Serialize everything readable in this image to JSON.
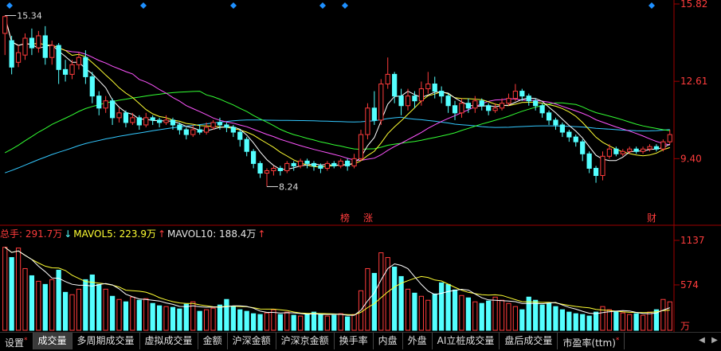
{
  "chart_data": [
    {
      "type": "candlestick",
      "panel": "price",
      "ylim": [
        7.0,
        15.82
      ],
      "y_ticks": [
        "15.82",
        "12.61",
        "9.40"
      ],
      "annotations": {
        "high": "15.34",
        "low": "8.24"
      },
      "event_markers": [
        "榜",
        "涨",
        "财"
      ],
      "candles": [
        [
          14.6,
          15.3,
          15.34,
          13.7
        ],
        [
          14.3,
          13.2,
          14.5,
          12.9
        ],
        [
          13.4,
          13.8,
          14.1,
          13.2
        ],
        [
          13.7,
          14.4,
          14.6,
          13.5
        ],
        [
          14.4,
          14.0,
          14.8,
          13.7
        ],
        [
          14.0,
          14.5,
          14.7,
          13.8
        ],
        [
          14.5,
          13.6,
          14.9,
          13.3
        ],
        [
          13.6,
          14.1,
          14.3,
          13.3
        ],
        [
          14.1,
          13.1,
          14.2,
          12.5
        ],
        [
          13.1,
          12.9,
          13.5,
          12.6
        ],
        [
          12.9,
          13.3,
          13.5,
          12.7
        ],
        [
          13.3,
          13.6,
          13.8,
          13.1
        ],
        [
          13.6,
          12.8,
          13.9,
          12.5
        ],
        [
          12.8,
          12.0,
          13.0,
          11.7
        ],
        [
          12.0,
          11.5,
          12.2,
          11.2
        ],
        [
          11.5,
          11.8,
          12.0,
          11.3
        ],
        [
          11.8,
          11.1,
          11.9,
          10.8
        ],
        [
          11.1,
          11.3,
          11.5,
          10.9
        ],
        [
          11.3,
          10.9,
          11.4,
          10.7
        ],
        [
          10.9,
          11.1,
          11.3,
          10.8
        ],
        [
          11.1,
          10.8,
          11.2,
          10.6
        ],
        [
          10.8,
          11.1,
          11.3,
          10.7
        ],
        [
          11.1,
          11.0,
          11.2,
          10.8
        ],
        [
          11.0,
          10.9,
          11.1,
          10.7
        ],
        [
          10.9,
          11.0,
          11.2,
          10.8
        ],
        [
          11.0,
          10.8,
          11.1,
          10.6
        ],
        [
          10.8,
          10.6,
          10.9,
          10.4
        ],
        [
          10.6,
          10.4,
          10.7,
          10.2
        ],
        [
          10.4,
          10.6,
          10.8,
          10.3
        ],
        [
          10.6,
          10.5,
          10.8,
          10.4
        ],
        [
          10.5,
          10.7,
          10.9,
          10.4
        ],
        [
          10.7,
          10.9,
          11.0,
          10.6
        ],
        [
          10.9,
          10.8,
          11.1,
          10.6
        ],
        [
          10.8,
          10.7,
          10.9,
          10.5
        ],
        [
          10.7,
          10.5,
          10.8,
          10.3
        ],
        [
          10.5,
          10.2,
          10.6,
          9.9
        ],
        [
          10.2,
          9.7,
          10.3,
          9.5
        ],
        [
          9.7,
          9.2,
          9.8,
          9.0
        ],
        [
          9.2,
          8.8,
          9.3,
          8.6
        ],
        [
          8.8,
          8.9,
          9.0,
          8.24
        ],
        [
          8.9,
          9.0,
          9.1,
          8.7
        ],
        [
          9.0,
          8.9,
          9.1,
          8.7
        ],
        [
          8.9,
          9.2,
          9.3,
          8.8
        ],
        [
          9.2,
          9.1,
          9.3,
          8.9
        ],
        [
          9.1,
          9.3,
          9.4,
          9.0
        ],
        [
          9.3,
          9.2,
          9.4,
          9.0
        ],
        [
          9.2,
          9.1,
          9.3,
          8.9
        ],
        [
          9.1,
          9.0,
          9.2,
          8.8
        ],
        [
          9.0,
          9.2,
          9.3,
          8.9
        ],
        [
          9.2,
          9.1,
          9.3,
          9.0
        ],
        [
          9.1,
          9.3,
          9.4,
          9.0
        ],
        [
          9.3,
          9.1,
          9.4,
          8.9
        ],
        [
          9.1,
          9.4,
          9.6,
          9.0
        ],
        [
          9.4,
          10.4,
          10.6,
          9.3
        ],
        [
          10.4,
          11.5,
          11.7,
          10.2
        ],
        [
          11.5,
          11.0,
          12.2,
          10.8
        ],
        [
          11.0,
          12.5,
          12.7,
          10.8
        ],
        [
          12.5,
          12.9,
          13.6,
          12.3
        ],
        [
          12.9,
          12.0,
          13.0,
          11.7
        ],
        [
          12.0,
          11.6,
          12.3,
          11.2
        ],
        [
          11.6,
          12.0,
          12.3,
          11.4
        ],
        [
          12.0,
          11.8,
          12.2,
          11.5
        ],
        [
          11.8,
          12.3,
          12.6,
          11.6
        ],
        [
          12.3,
          12.5,
          13.0,
          12.1
        ],
        [
          12.5,
          12.2,
          12.8,
          11.9
        ],
        [
          12.2,
          12.0,
          12.4,
          11.7
        ],
        [
          12.0,
          11.6,
          12.1,
          11.3
        ],
        [
          11.6,
          11.3,
          11.8,
          11.0
        ],
        [
          11.3,
          11.7,
          11.9,
          11.1
        ],
        [
          11.7,
          11.5,
          11.9,
          11.3
        ],
        [
          11.5,
          11.8,
          12.0,
          11.3
        ],
        [
          11.8,
          11.6,
          11.9,
          11.4
        ],
        [
          11.6,
          11.4,
          11.7,
          11.2
        ],
        [
          11.4,
          11.5,
          11.7,
          11.3
        ],
        [
          11.5,
          11.7,
          11.9,
          11.4
        ],
        [
          11.7,
          11.9,
          12.1,
          11.6
        ],
        [
          11.9,
          12.2,
          12.5,
          11.8
        ],
        [
          12.2,
          12.0,
          12.3,
          11.8
        ],
        [
          12.0,
          11.8,
          12.1,
          11.6
        ],
        [
          11.8,
          11.6,
          11.9,
          11.4
        ],
        [
          11.6,
          11.3,
          11.7,
          11.1
        ],
        [
          11.3,
          11.0,
          11.4,
          10.8
        ],
        [
          11.0,
          10.8,
          11.1,
          10.6
        ],
        [
          10.8,
          10.5,
          10.9,
          10.3
        ],
        [
          10.5,
          10.3,
          10.6,
          10.1
        ],
        [
          10.3,
          10.1,
          10.4,
          9.9
        ],
        [
          10.1,
          9.6,
          10.2,
          9.3
        ],
        [
          9.6,
          9.0,
          9.7,
          8.8
        ],
        [
          9.0,
          8.7,
          9.1,
          8.4
        ],
        [
          8.7,
          9.5,
          9.7,
          8.5
        ],
        [
          9.5,
          9.8,
          10.0,
          9.4
        ],
        [
          9.8,
          9.6,
          9.9,
          9.5
        ],
        [
          9.6,
          9.7,
          9.8,
          9.5
        ],
        [
          9.7,
          9.8,
          9.9,
          9.6
        ],
        [
          9.8,
          9.7,
          9.9,
          9.6
        ],
        [
          9.7,
          9.8,
          9.9,
          9.6
        ],
        [
          9.8,
          9.9,
          10.0,
          9.7
        ],
        [
          9.9,
          9.8,
          10.0,
          9.7
        ],
        [
          9.8,
          10.1,
          10.2,
          9.7
        ],
        [
          10.1,
          10.4,
          10.6,
          10.0
        ]
      ]
    },
    {
      "type": "bar",
      "panel": "volume",
      "ylim": [
        0,
        1137
      ],
      "y_ticks": [
        "1137",
        "574"
      ],
      "unit": "万",
      "legend": [
        {
          "label": "总手: 291.7万",
          "arrow": "↓"
        },
        {
          "label": "MAVOL5: 223.9万",
          "arrow": "↑"
        },
        {
          "label": "MAVOL10: 188.4万",
          "arrow": "↑"
        }
      ],
      "values": [
        1050,
        920,
        1040,
        780,
        690,
        620,
        580,
        640,
        760,
        480,
        450,
        520,
        640,
        700,
        580,
        520,
        430,
        390,
        360,
        420,
        380,
        400,
        340,
        310,
        300,
        290,
        270,
        330,
        360,
        240,
        260,
        280,
        320,
        390,
        300,
        260,
        240,
        210,
        200,
        220,
        260,
        200,
        230,
        190,
        180,
        210,
        230,
        200,
        180,
        190,
        210,
        170,
        200,
        500,
        780,
        720,
        980,
        920,
        800,
        680,
        520,
        470,
        430,
        380,
        460,
        600,
        580,
        510,
        440,
        410,
        360,
        340,
        370,
        420,
        380,
        340,
        300,
        260,
        420,
        380,
        320,
        340,
        300,
        260,
        230,
        210,
        200,
        180,
        230,
        300,
        260,
        240,
        220,
        200,
        210,
        190,
        230,
        260,
        390,
        360
      ]
    }
  ],
  "tabs": [
    {
      "label": "设置",
      "mark": "*"
    },
    {
      "label": "成交量"
    },
    {
      "label": "多周期成交量"
    },
    {
      "label": "虚拟成交量"
    },
    {
      "label": "金额"
    },
    {
      "label": "沪深金额"
    },
    {
      "label": "沪深京金额"
    },
    {
      "label": "换手率"
    },
    {
      "label": "内盘"
    },
    {
      "label": "外盘"
    },
    {
      "label": "AI立桩成交量"
    },
    {
      "label": "盘后成交量"
    },
    {
      "label": "市盈率(ttm)",
      "mark": "*"
    }
  ],
  "colors": {
    "up": "#ff3c3c",
    "down": "#54ffff",
    "axis": "#a00000",
    "ma5": "#ffffff",
    "ma10": "#ffff33",
    "ma20": "#ff55ff",
    "ma30": "#33ff33",
    "ma60": "#33c8ff",
    "diamond": "#1e90ff",
    "text": "#d0d0d0"
  }
}
